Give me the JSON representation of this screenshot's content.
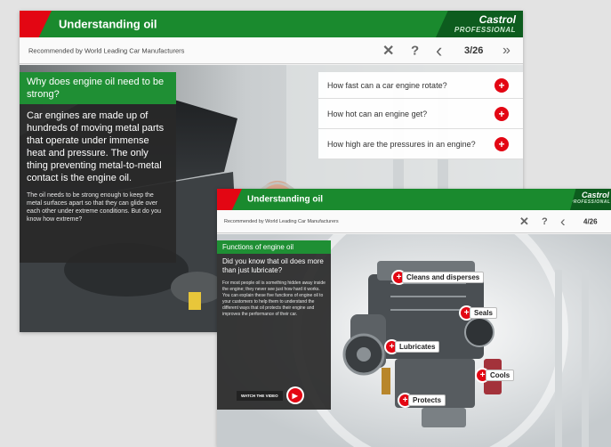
{
  "screen1": {
    "title": "Understanding oil",
    "brand": {
      "logo": "Castrol",
      "sub": "PROFESSIONAL"
    },
    "tagline": "Recommended by World Leading Car Manufacturers",
    "nav": {
      "close": "✕",
      "help": "?",
      "prev": "‹",
      "counter": "3/26",
      "next": "»"
    },
    "panel": {
      "heading": "Why does engine oil need to be strong?",
      "body": "Car engines are made up of hundreds of moving metal parts that operate under immense heat and pressure. The only thing preventing metal-to-metal contact is the engine oil.",
      "note": "The oil needs to be strong enough to keep the metal surfaces apart so that they can glide over each other under extreme conditions. But do you know how extreme?"
    },
    "questions": [
      "How fast can a car engine rotate?",
      "How hot can an engine get?",
      "How high are the pressures in an engine?"
    ]
  },
  "screen2": {
    "title": "Understanding oil",
    "brand": {
      "logo": "Castrol",
      "sub": "PROFESSIONAL"
    },
    "tagline": "Recommended by World Leading Car Manufacturers",
    "nav": {
      "close": "✕",
      "help": "?",
      "prev": "‹",
      "counter": "4/26"
    },
    "panel": {
      "heading": "Functions of engine oil",
      "lead": "Did you know that oil does more than just lubricate?",
      "body": "For most people oil is something hidden away inside the engine; they never see just how hard it works. You can explain these five functions of engine oil to your customers to help them to understand the different ways that oil protects their engine and improves the performance of their car.",
      "video_label": "WATCH THE VIDEO"
    },
    "hotspots": [
      "Cleans and disperses",
      "Seals",
      "Lubricates",
      "Cools",
      "Protects"
    ]
  },
  "colors": {
    "green": "#1a8a2e",
    "red": "#e30613",
    "dark_green": "#0d5c1e"
  }
}
